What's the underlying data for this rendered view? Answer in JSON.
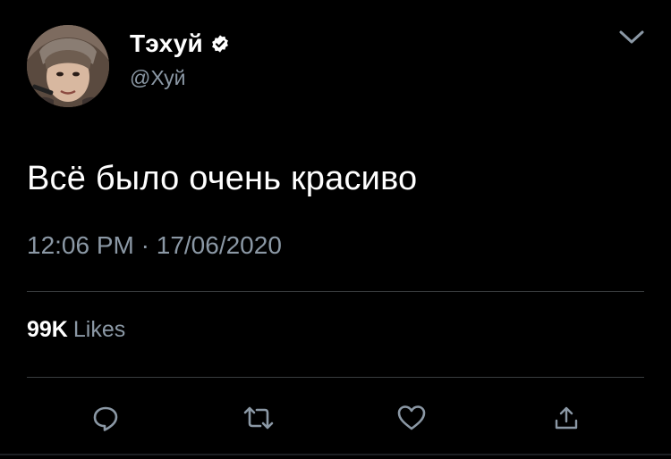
{
  "tweet": {
    "author": {
      "display_name": "Тэхуй",
      "handle": "@Хуй",
      "verified": true
    },
    "text": "Всё было очень красиво",
    "timestamp": {
      "time": "12:06 PM",
      "separator": "·",
      "date": "17/06/2020"
    },
    "stats": {
      "likes_count": "99K",
      "likes_label": "Likes"
    }
  },
  "icons": {
    "more": "chevron-down-icon",
    "verified": "verified-badge-icon",
    "reply": "reply-icon",
    "retweet": "retweet-icon",
    "like": "heart-icon",
    "share": "share-icon"
  },
  "colors": {
    "background": "#000000",
    "primary_text": "#ffffff",
    "secondary_text": "#8b98a5",
    "divider": "#3a3d40",
    "icon": "#8b98a5"
  }
}
